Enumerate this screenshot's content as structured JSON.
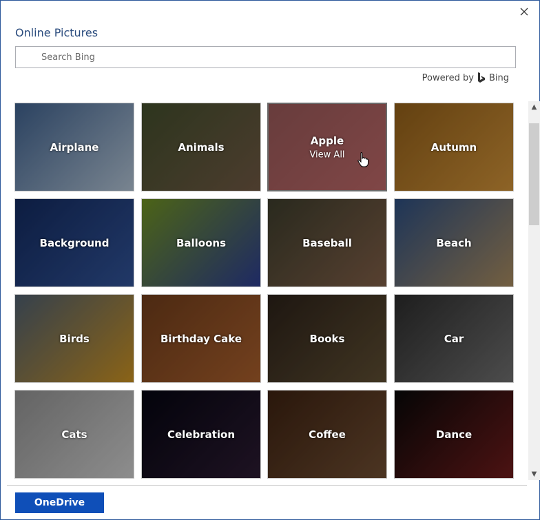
{
  "dialog": {
    "title": "Online Pictures",
    "close_icon": "close-icon"
  },
  "search": {
    "placeholder": "Search Bing",
    "value": ""
  },
  "powered_by": {
    "label": "Powered by",
    "brand": "Bing",
    "brand_icon": "bing-logo-icon"
  },
  "categories": [
    {
      "label": "Airplane",
      "c1": "#3c5c86",
      "c2": "#a8b8c8"
    },
    {
      "label": "Animals",
      "c1": "#3f4a2a",
      "c2": "#6a5440"
    },
    {
      "label": "Apple",
      "sub": "View All",
      "c1": "#7a1a1a",
      "c2": "#b03030",
      "hover": true
    },
    {
      "label": "Autumn",
      "c1": "#8a5a18",
      "c2": "#c48a36"
    },
    {
      "label": "Background",
      "c1": "#12285a",
      "c2": "#2f4f90"
    },
    {
      "label": "Balloons",
      "c1": "#6a8a20",
      "c2": "#2a3a8a"
    },
    {
      "label": "Baseball",
      "c1": "#3a3a2a",
      "c2": "#7a5a44"
    },
    {
      "label": "Beach",
      "c1": "#2a4a7a",
      "c2": "#a0845a"
    },
    {
      "label": "Birds",
      "c1": "#4a5a6a",
      "c2": "#c08a20"
    },
    {
      "label": "Birthday Cake",
      "c1": "#6a3a1a",
      "c2": "#a05a2a"
    },
    {
      "label": "Books",
      "c1": "#2a2018",
      "c2": "#5a4a30"
    },
    {
      "label": "Car",
      "c1": "#2a2a2a",
      "c2": "#6a6a6a"
    },
    {
      "label": "Cats",
      "c1": "#8a8a8a",
      "c2": "#c4c4c4"
    },
    {
      "label": "Celebration",
      "c1": "#050510",
      "c2": "#2a1a30"
    },
    {
      "label": "Coffee",
      "c1": "#3a2010",
      "c2": "#6a4a30"
    },
    {
      "label": "Dance",
      "c1": "#080808",
      "c2": "#6a1a1a"
    }
  ],
  "scrollbar": {
    "up_icon": "chevron-up-icon",
    "down_icon": "chevron-down-icon"
  },
  "footer": {
    "onedrive_label": "OneDrive"
  }
}
